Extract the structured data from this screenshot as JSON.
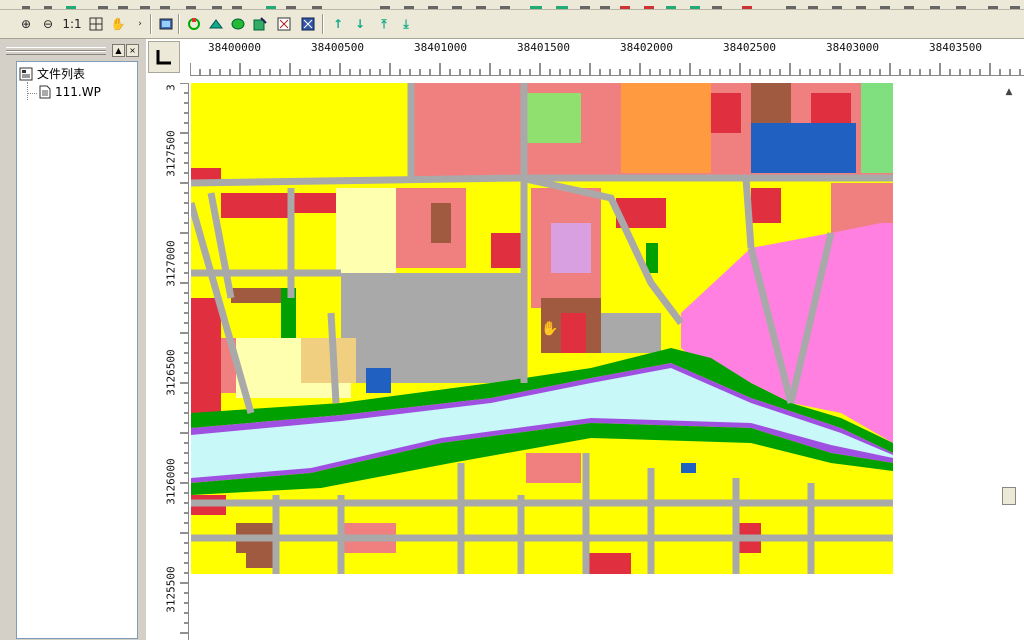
{
  "toolbar": {
    "zoom_in": "⊕",
    "zoom_out": "⊖",
    "actual_size": "1:1",
    "pan": "✋",
    "up_label": "↑",
    "down_label": "↓",
    "top_label": "⤒",
    "bottom_label": "⤓"
  },
  "file_panel": {
    "title": "文件列表",
    "files": [
      "111.WP"
    ]
  },
  "rulers": {
    "x_ticks": [
      "38400000",
      "38400500",
      "38401000",
      "38401500",
      "38402000",
      "38402500",
      "38403000",
      "38403500"
    ],
    "y_ticks": [
      "3127500",
      "3127000",
      "3126500",
      "3126000",
      "3125500"
    ],
    "y_top_partial": "3"
  },
  "colors": {
    "road": "#a9a9a9",
    "residential": "#ffff00",
    "commercial": "#f08080",
    "industrial": "#e03040",
    "park": "#00a000",
    "water": "#c8f8f8",
    "river_edge": "#a050e0",
    "special": "#ff80e0",
    "institution": "#2060c0",
    "brown": "#a05a40"
  }
}
